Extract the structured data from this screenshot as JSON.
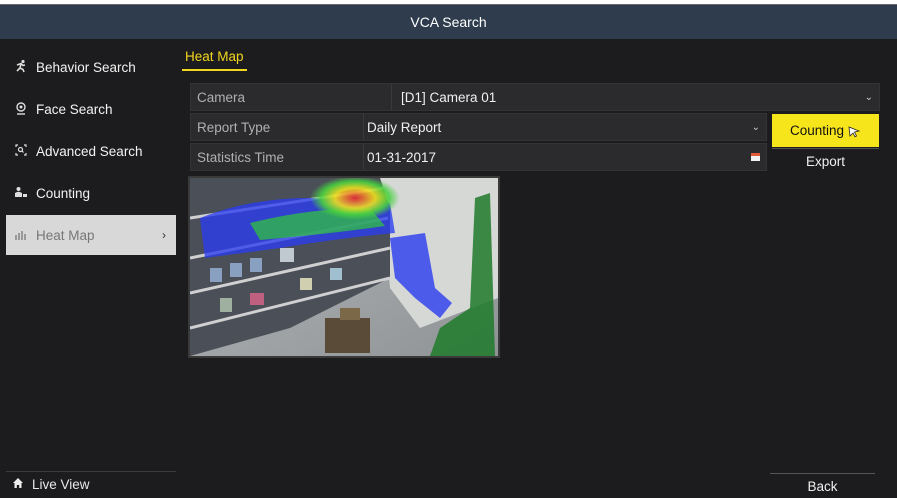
{
  "window": {
    "title": "VCA Search"
  },
  "sidebar": {
    "items": [
      {
        "label": "Behavior Search",
        "icon": "running-person-icon",
        "active": false
      },
      {
        "label": "Face Search",
        "icon": "face-icon",
        "active": false
      },
      {
        "label": "Advanced Search",
        "icon": "scan-search-icon",
        "active": false
      },
      {
        "label": "Counting",
        "icon": "people-count-icon",
        "active": false
      },
      {
        "label": "Heat Map",
        "icon": "heat-map-icon",
        "active": true
      }
    ],
    "live_view": {
      "label": "Live View",
      "icon": "home-icon"
    }
  },
  "main": {
    "tab": "Heat Map",
    "camera": {
      "label": "Camera",
      "value": "[D1] Camera 01"
    },
    "report_type": {
      "label": "Report Type",
      "value": "Daily Report"
    },
    "statistics_time": {
      "label": "Statistics Time",
      "value": "01-31-2017"
    },
    "buttons": {
      "counting": "Counting",
      "export": "Export",
      "back": "Back"
    }
  },
  "colors": {
    "accent": "#f7e51b",
    "title_bar": "#2e3c4d",
    "background": "#1c1c1e",
    "active_item": "#d8d8d8"
  }
}
